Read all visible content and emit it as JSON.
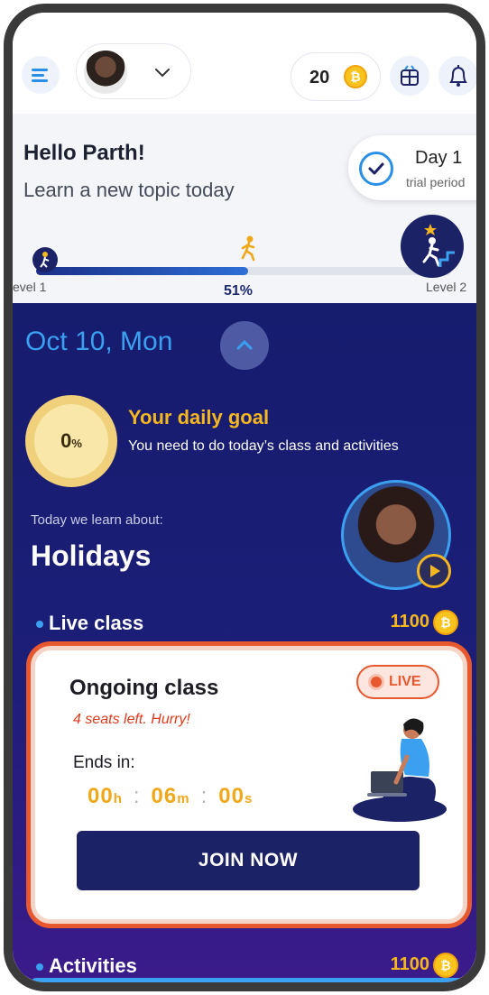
{
  "header": {
    "coins": "20",
    "coin_symbol": "₿"
  },
  "greeting": {
    "title": "Hello Parth!",
    "subtitle": "Learn a new topic today",
    "trial": {
      "day": "Day 1",
      "label": "trial period"
    }
  },
  "level_progress": {
    "percent": 51,
    "percent_label": "51%",
    "from_label": "evel 1",
    "to_label": "Level 2"
  },
  "schedule": {
    "date": "Oct 10, Mon"
  },
  "daily_goal": {
    "percent": "0",
    "percent_unit": "%",
    "title": "Your daily goal",
    "subtitle": "You need to do today’s class and activities"
  },
  "lesson": {
    "label": "Today we learn about:",
    "topic": "Holidays"
  },
  "live_class": {
    "section_label": "Live class",
    "points": "1100",
    "card_title": "Ongoing class",
    "seats": "4 seats left. Hurry!",
    "badge": "LIVE",
    "ends_label": "Ends in:",
    "hours": "00",
    "hours_unit": "h",
    "minutes": "06",
    "minutes_unit": "m",
    "seconds": "00",
    "seconds_unit": "s",
    "join_label": "JOIN NOW"
  },
  "activities": {
    "section_label": "Activities",
    "points": "1100"
  },
  "colors": {
    "brand_navy": "#1c2266",
    "accent_blue": "#3ba0f0",
    "gold": "#f5b71f",
    "live_red": "#e8582f"
  }
}
